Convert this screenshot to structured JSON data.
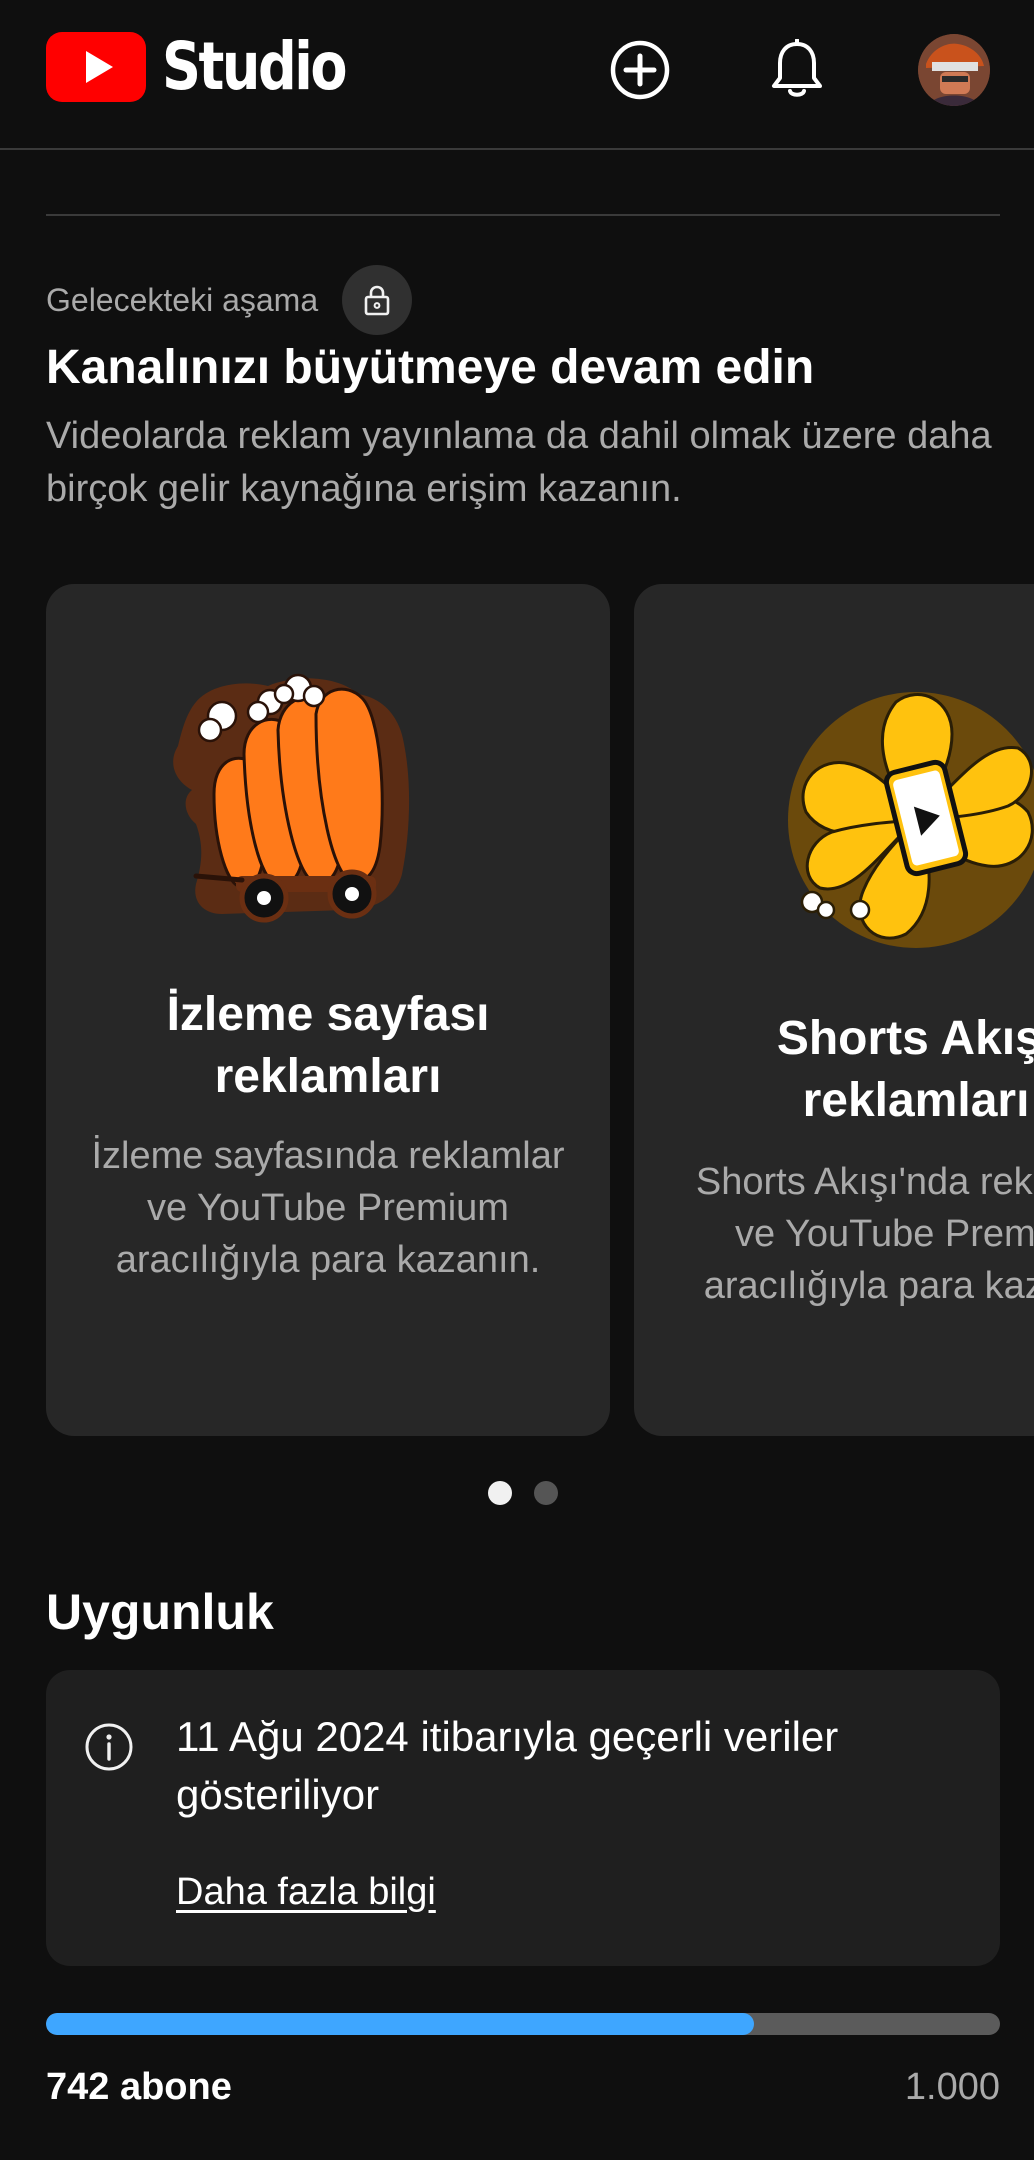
{
  "header": {
    "logo_text": "Studio",
    "icons": [
      "youtube-logo-icon",
      "create-icon",
      "bell-icon",
      "avatar"
    ]
  },
  "stage": {
    "label": "Gelecekteki aşama",
    "lock_icon": "lock-icon"
  },
  "intro": {
    "heading": "Kanalınızı büyütmeye devam edin",
    "description": "Videolarda reklam yayınlama da dahil olmak üzere daha birçok gelir kaynağına erişim kazanın."
  },
  "cards": [
    {
      "illustration": "cart-illustration",
      "title_line1": "İzleme sayfası",
      "title_line2": "reklamları",
      "description": "İzleme sayfasında reklamlar ve YouTube Premium aracılığıyla para kazanın."
    },
    {
      "illustration": "shorts-feed-illustration",
      "title_line1": "Shorts Akışı",
      "title_line2": "reklamları",
      "description": "Shorts Akışı'nda reklamlar ve YouTube Premium aracılığıyla para kazanın."
    }
  ],
  "pager": {
    "count": 2,
    "active_index": 0
  },
  "eligibility": {
    "title": "Uygunluk",
    "info_icon": "info-icon",
    "info_text": "11 Ağu 2024 itibarıyla geçerli veriler gösteriliyor",
    "link_label": "Daha fazla bilgi",
    "progress_current_label": "742 abone",
    "progress_target_label": "1.000",
    "progress_fraction": 0.742
  },
  "colors": {
    "background": "#0f0f0f",
    "card": "#272727",
    "info_card": "#1f1f1f",
    "accent_blue": "#3ea6ff",
    "youtube_red": "#ff0000",
    "muted_text": "#aaaaaa"
  }
}
